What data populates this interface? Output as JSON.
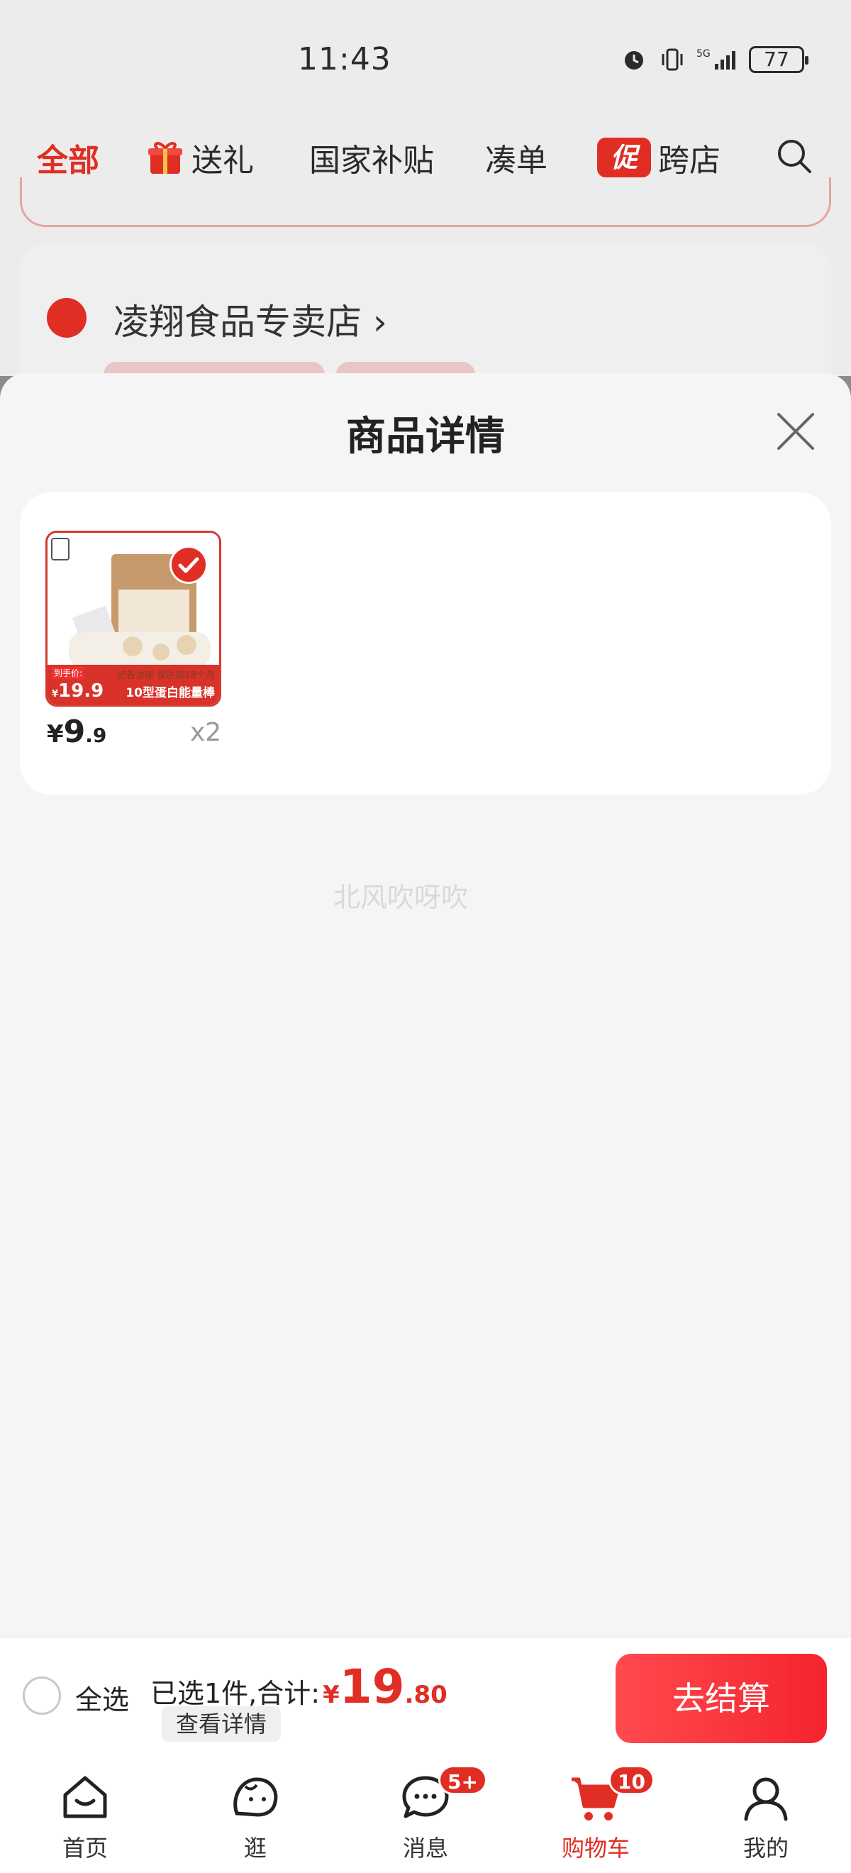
{
  "status_bar": {
    "time": "11:43",
    "battery": "77"
  },
  "category_tabs": [
    {
      "label": "全部",
      "active": true
    },
    {
      "label": "送礼",
      "icon": "gift-icon"
    },
    {
      "label": "国家补贴"
    },
    {
      "label": "凑单"
    },
    {
      "label": "跨店",
      "badge": "促"
    }
  ],
  "store": {
    "name": "凌翔食品专卖店"
  },
  "sheet": {
    "title": "商品详情",
    "item": {
      "image_labels": {
        "tag_label": "到手价:",
        "tag_price": "19.9",
        "desc": "奶香浓郁 保质期18个月",
        "name": "10型蛋白能量棒"
      },
      "price_currency": "¥",
      "price_int": "9",
      "price_dec": ".9",
      "quantity": "x2",
      "selected": true
    },
    "watermark": "北风吹呀吹"
  },
  "checkout": {
    "select_all": "全选",
    "summary": "已选1件,合计:",
    "total_currency": "¥",
    "total_int": "19",
    "total_dec": ".80",
    "details": "查看详情",
    "button": "去结算"
  },
  "bottom_nav": [
    {
      "label": "首页",
      "icon": "home-icon"
    },
    {
      "label": "逛",
      "icon": "browse-icon"
    },
    {
      "label": "消息",
      "icon": "message-icon",
      "badge": "5+"
    },
    {
      "label": "购物车",
      "icon": "cart-icon",
      "badge": "10",
      "active": true
    },
    {
      "label": "我的",
      "icon": "profile-icon"
    }
  ],
  "colors": {
    "accent": "#e02e24",
    "overlay": "#8c8c8c",
    "sheet_bg": "#f5f5f5"
  }
}
